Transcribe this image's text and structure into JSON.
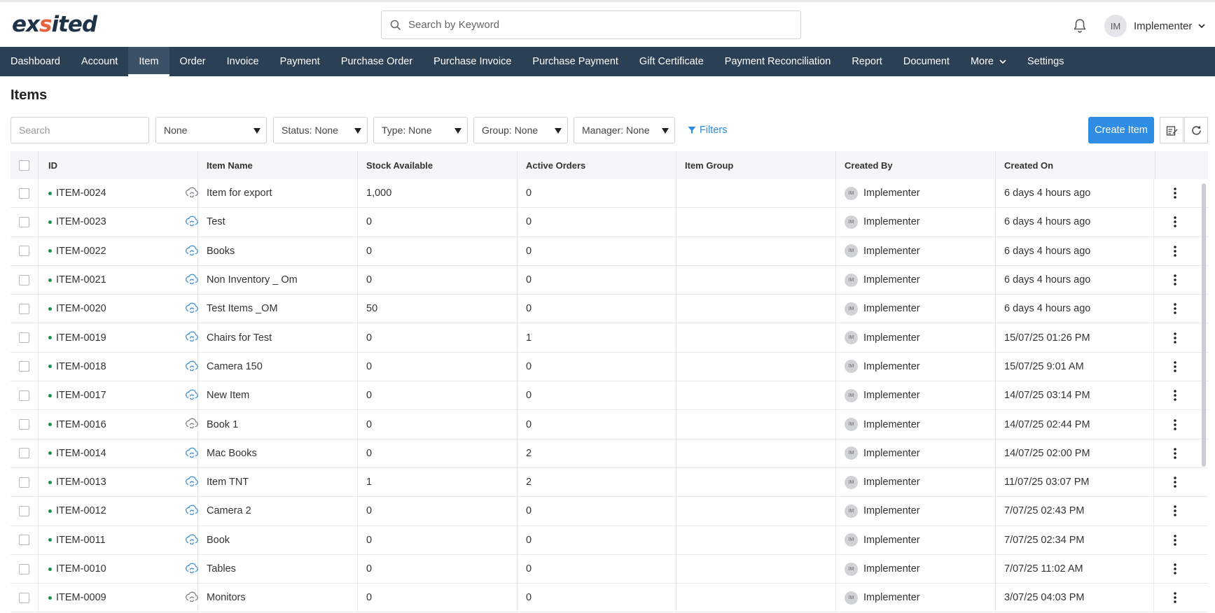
{
  "app": {
    "logo_text_1": "ex",
    "logo_text_2": "s",
    "logo_text_3": "ited"
  },
  "header": {
    "search_placeholder": "Search by Keyword",
    "user_initials": "IM",
    "user_name": "Implementer"
  },
  "nav": {
    "items": [
      "Dashboard",
      "Account",
      "Item",
      "Order",
      "Invoice",
      "Payment",
      "Purchase Order",
      "Purchase Invoice",
      "Purchase Payment",
      "Gift Certificate",
      "Payment Reconciliation",
      "Report",
      "Document",
      "More",
      "Settings"
    ],
    "active": "Item"
  },
  "page": {
    "title": "Items"
  },
  "toolbar": {
    "search_placeholder": "Search",
    "dropdowns": [
      "None",
      "Status: None",
      "Type: None",
      "Group: None",
      "Manager: None"
    ],
    "filters_label": "Filters",
    "create_label": "Create Item"
  },
  "table": {
    "columns": [
      "ID",
      "Item Name",
      "Stock Available",
      "Active Orders",
      "Item Group",
      "Created By",
      "Created On"
    ],
    "rows": [
      {
        "id": "ITEM-0024",
        "name": "Item for export",
        "stock": "1,000",
        "orders": "0",
        "group": "",
        "initials": "IM",
        "created_by": "Implementer",
        "created_on": "6 days 4 hours ago",
        "sync": "grey"
      },
      {
        "id": "ITEM-0023",
        "name": "Test",
        "stock": "0",
        "orders": "0",
        "group": "",
        "initials": "IM",
        "created_by": "Implementer",
        "created_on": "6 days 4 hours ago",
        "sync": "blue"
      },
      {
        "id": "ITEM-0022",
        "name": "Books",
        "stock": "0",
        "orders": "0",
        "group": "",
        "initials": "IM",
        "created_by": "Implementer",
        "created_on": "6 days 4 hours ago",
        "sync": "blue"
      },
      {
        "id": "ITEM-0021",
        "name": "Non Inventory _ Om",
        "stock": "0",
        "orders": "0",
        "group": "",
        "initials": "IM",
        "created_by": "Implementer",
        "created_on": "6 days 4 hours ago",
        "sync": "blue"
      },
      {
        "id": "ITEM-0020",
        "name": "Test Items _OM",
        "stock": "50",
        "orders": "0",
        "group": "",
        "initials": "IM",
        "created_by": "Implementer",
        "created_on": "6 days 4 hours ago",
        "sync": "blue"
      },
      {
        "id": "ITEM-0019",
        "name": "Chairs for Test",
        "stock": "0",
        "orders": "1",
        "group": "",
        "initials": "IM",
        "created_by": "Implementer",
        "created_on": "15/07/25 01:26 PM",
        "sync": "blue"
      },
      {
        "id": "ITEM-0018",
        "name": "Camera 150",
        "stock": "0",
        "orders": "0",
        "group": "",
        "initials": "IM",
        "created_by": "Implementer",
        "created_on": "15/07/25 9:01 AM",
        "sync": "blue"
      },
      {
        "id": "ITEM-0017",
        "name": "New Item",
        "stock": "0",
        "orders": "0",
        "group": "",
        "initials": "IM",
        "created_by": "Implementer",
        "created_on": "14/07/25 03:14 PM",
        "sync": "blue"
      },
      {
        "id": "ITEM-0016",
        "name": "Book 1",
        "stock": "0",
        "orders": "0",
        "group": "",
        "initials": "IM",
        "created_by": "Implementer",
        "created_on": "14/07/25 02:44 PM",
        "sync": "grey"
      },
      {
        "id": "ITEM-0014",
        "name": "Mac Books",
        "stock": "0",
        "orders": "2",
        "group": "",
        "initials": "IM",
        "created_by": "Implementer",
        "created_on": "14/07/25 02:00 PM",
        "sync": "blue"
      },
      {
        "id": "ITEM-0013",
        "name": "Item TNT",
        "stock": "1",
        "orders": "2",
        "group": "",
        "initials": "IM",
        "created_by": "Implementer",
        "created_on": "11/07/25 03:07 PM",
        "sync": "blue"
      },
      {
        "id": "ITEM-0012",
        "name": "Camera 2",
        "stock": "0",
        "orders": "0",
        "group": "",
        "initials": "IM",
        "created_by": "Implementer",
        "created_on": "7/07/25 02:43 PM",
        "sync": "blue"
      },
      {
        "id": "ITEM-0011",
        "name": "Book",
        "stock": "0",
        "orders": "0",
        "group": "",
        "initials": "IM",
        "created_by": "Implementer",
        "created_on": "7/07/25 02:34 PM",
        "sync": "blue"
      },
      {
        "id": "ITEM-0010",
        "name": "Tables",
        "stock": "0",
        "orders": "0",
        "group": "",
        "initials": "IM",
        "created_by": "Implementer",
        "created_on": "7/07/25 11:02 AM",
        "sync": "blue"
      },
      {
        "id": "ITEM-0009",
        "name": "Monitors",
        "stock": "0",
        "orders": "0",
        "group": "",
        "initials": "IM",
        "created_by": "Implementer",
        "created_on": "3/07/25 04:03 PM",
        "sync": "grey"
      }
    ]
  },
  "colors": {
    "nav_bg": "#2b4055",
    "accent": "#2f8de4",
    "status_active": "#1a8f4f",
    "sync_blue": "#3a8fd9",
    "sync_grey": "#7a7f85"
  }
}
